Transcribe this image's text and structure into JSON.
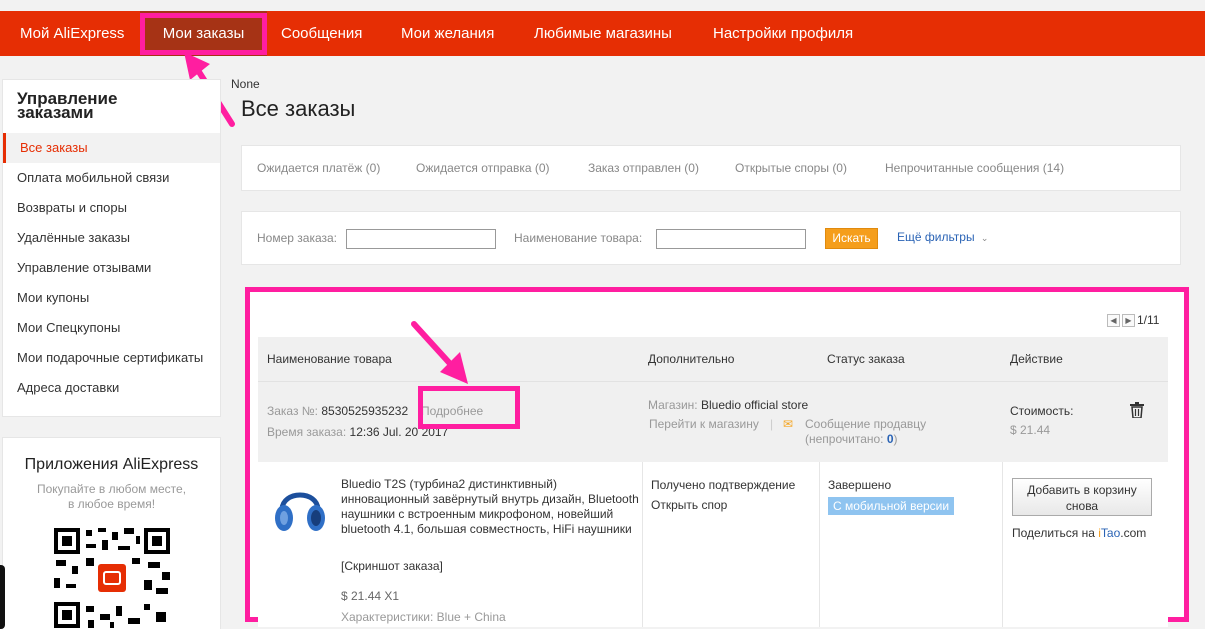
{
  "nav": {
    "items": [
      "Мой AliExpress",
      "Мои заказы",
      "Сообщения",
      "Мои желания",
      "Любимые магазины",
      "Настройки профиля"
    ]
  },
  "sidebar": {
    "title": "Управление заказами",
    "items": [
      "Все заказы",
      "Оплата мобильной связи",
      "Возвраты и споры",
      "Удалённые заказы",
      "Управление отзывами",
      "Мои купоны",
      "Мои Спецкупоны",
      "Мои подарочные сертификаты",
      "Адреса доставки"
    ]
  },
  "apps": {
    "title": "Приложения AliExpress",
    "subtitle": "Покупайте в любом месте, в любое время!"
  },
  "breadcrumb": "None",
  "page_title": "Все заказы",
  "status_tabs": [
    "Ожидается платёж (0)",
    "Ожидается отправка (0)",
    "Заказ отправлен (0)",
    "Открытые споры (0)",
    "Непрочитанные сообщения (14)"
  ],
  "filters": {
    "order_number_label": "Номер заказа:",
    "product_name_label": "Наименование товара:",
    "search_button": "Искать",
    "more_filters": "Ещё фильтры"
  },
  "pager": {
    "text": "1/11"
  },
  "table": {
    "headers": [
      "Наименование товара",
      "Дополнительно",
      "Статус заказа",
      "Действие"
    ]
  },
  "order": {
    "number_label": "Заказ №:",
    "number": "8530525935232",
    "details_link": "Подробнее",
    "time_label": "Время заказа:",
    "time": "12:36 Jul. 20 2017",
    "store_label": "Магазин:",
    "store": "Bluedio official store",
    "go_to_store": "Перейти к магазину",
    "message_seller": "Сообщение продавцу",
    "unread_label": "(непрочитано:",
    "unread_count": "0",
    "unread_close": ")",
    "cost_label": "Стоимость:",
    "cost": "$ 21.44",
    "item": {
      "title": "Bluedio T2S (турбина2 дистинктивный) инновационный завёрнутый внутрь дизайн, Bluetooth наушники с встроенным микрофоном, новейший bluetooth 4.1, большая совместность, HiFi наушники",
      "snapshot": "[Скриншот заказа]",
      "price_qty": "$ 21.44 X1",
      "specs": "Характеристики: Blue + China",
      "extra_status": "Получено подтверждение",
      "open_dispute": "Открыть спор",
      "status": "Завершено",
      "mobile_badge": "С мобильной версии",
      "add_to_cart": "Добавить в корзину снова",
      "share_prefix": "Поделиться на",
      "share_i": "i",
      "share_tao": "Tao",
      "share_com": ".com"
    }
  },
  "colors": {
    "brand": "#e62e04",
    "highlight": "#ff1ea0",
    "link": "#2a63b5",
    "search_button": "#f59e1c"
  }
}
